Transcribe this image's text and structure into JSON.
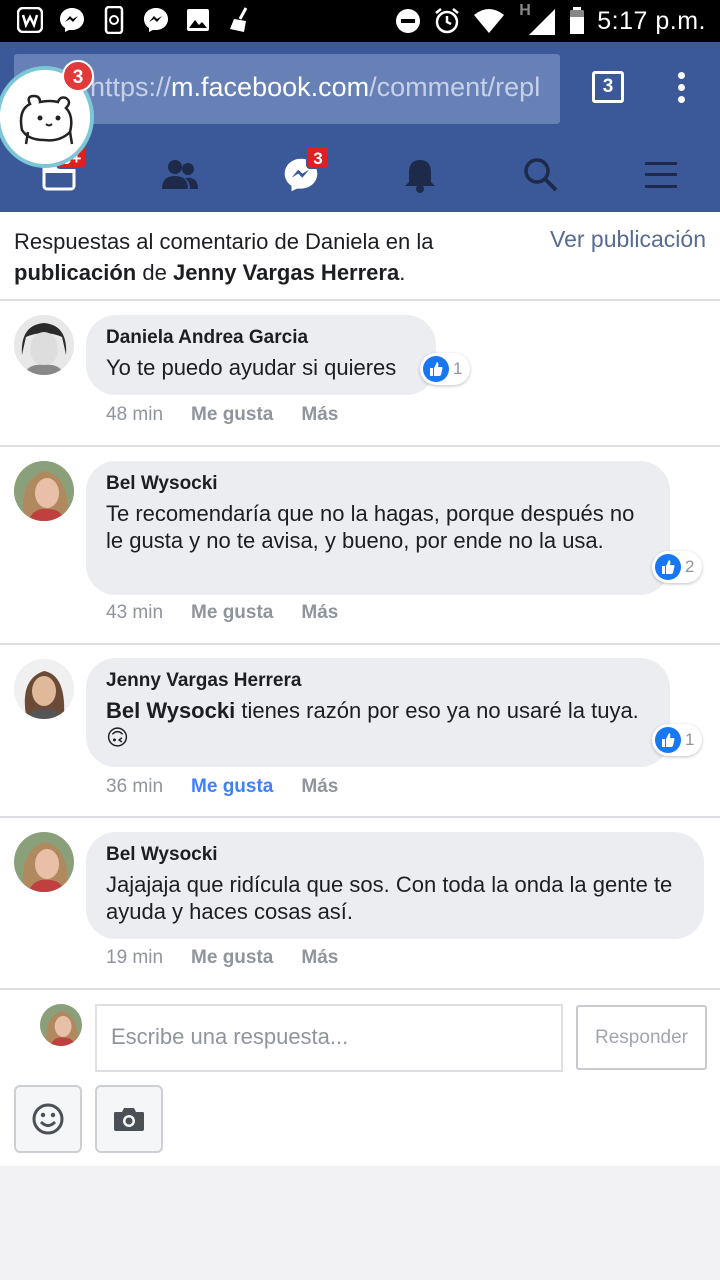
{
  "status_bar": {
    "time": "5:17 p.m.",
    "network_label": "H",
    "left_icons": [
      "wattpad-icon",
      "messenger-icon",
      "phone-sync-icon",
      "messenger-icon",
      "gallery-icon",
      "broom-icon"
    ],
    "right_icons": [
      "dnd-icon",
      "alarm-icon",
      "wifi-icon",
      "signal-icon",
      "battery-icon"
    ]
  },
  "browser": {
    "url_prefix": "https://",
    "url_host": "m.facebook.com",
    "url_path": "/comment/repl",
    "tab_count": "3"
  },
  "chat_head": {
    "badge": "3"
  },
  "nav": {
    "feed_badge": "9+",
    "messages_badge": "3",
    "items": [
      "feed-icon",
      "friends-icon",
      "messenger-icon",
      "notifications-icon",
      "search-icon",
      "menu-icon"
    ]
  },
  "header": {
    "line1_prefix": "Respuestas al comentario de Daniela en la",
    "line2_bold1": "publicación",
    "line2_mid": " de ",
    "line2_bold2": "Jenny Vargas Herrera",
    "line2_end": ".",
    "view_post": "Ver publicación"
  },
  "comments": [
    {
      "author": "Daniela Andrea Garcia",
      "text": "Yo te puedo ayudar si quieres",
      "likes": "1",
      "time": "48 min",
      "like_label": "Me gusta",
      "more_label": "Más"
    },
    {
      "author": "Bel Wysocki",
      "text": "Te recomendaría que no la hagas, porque después no le gusta y no te avisa, y bueno, por ende no la usa.",
      "likes": "2",
      "time": "43 min",
      "like_label": "Me gusta",
      "more_label": "Más"
    },
    {
      "author": "Jenny Vargas Herrera",
      "mention": "Bel Wysocki",
      "text": " tienes razón por eso ya no usaré la tuya. ",
      "emoji": "🙃",
      "likes": "1",
      "time": "36 min",
      "like_label": "Me gusta",
      "more_label": "Más"
    },
    {
      "author": "Bel Wysocki",
      "text": "Jajajaja que ridícula que sos. Con toda la onda la gente te ayuda y haces cosas así.",
      "time": "19 min",
      "like_label": "Me gusta",
      "more_label": "Más"
    }
  ],
  "composer": {
    "placeholder": "Escribe una respuesta...",
    "reply_label": "Responder",
    "tools": [
      "emoji-icon",
      "camera-icon"
    ]
  },
  "colors": {
    "facebook_blue": "#3b5998",
    "url_box": "#6781b6",
    "link_blue": "#4080ff",
    "badge_red": "#e02020",
    "bubble_gray": "#ebedf0"
  }
}
